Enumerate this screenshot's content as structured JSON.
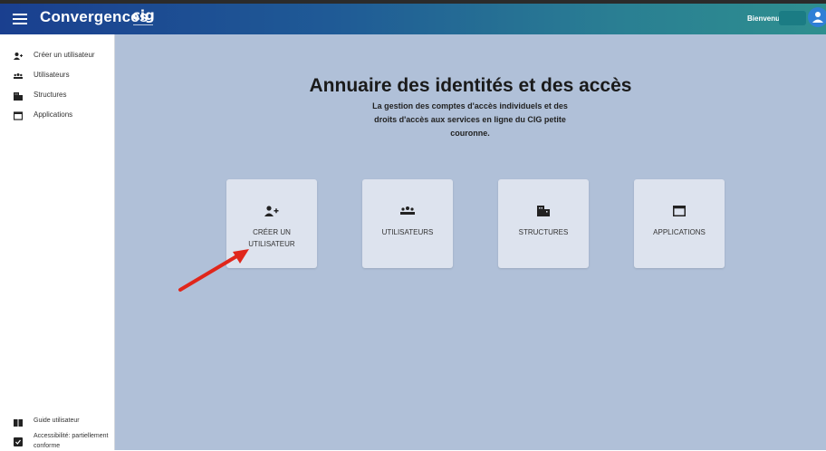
{
  "header": {
    "app_title": "Convergences",
    "logo_text": "cig",
    "welcome_text": "Bienvenue,"
  },
  "sidebar": {
    "items": [
      {
        "label": "Créer un utilisateur",
        "icon": "add-user-icon"
      },
      {
        "label": "Utilisateurs",
        "icon": "users-icon"
      },
      {
        "label": "Structures",
        "icon": "building-icon"
      },
      {
        "label": "Applications",
        "icon": "window-icon"
      }
    ],
    "bottom_items": [
      {
        "label": "Guide utilisateur",
        "icon": "book-icon"
      },
      {
        "label": "Accessibilité: partiellement conforme",
        "icon": "accessibility-icon"
      }
    ]
  },
  "main": {
    "title": "Annuaire des identités et des accès",
    "subtitle": "La gestion des comptes d'accès individuels et des droits d'accès aux services en ligne du CIG petite couronne.",
    "cards": [
      {
        "label": "CRÉER UN UTILISATEUR",
        "icon": "add-user-icon"
      },
      {
        "label": "UTILISATEURS",
        "icon": "users-icon"
      },
      {
        "label": "STRUCTURES",
        "icon": "building-icon"
      },
      {
        "label": "APPLICATIONS",
        "icon": "window-icon"
      }
    ]
  },
  "colors": {
    "topbar_start": "#1a3f8f",
    "topbar_end": "#2e8f8f",
    "main_bg": "#b0c0d8",
    "card_bg": "#dde3ee",
    "annotation_arrow": "#e0261b"
  }
}
